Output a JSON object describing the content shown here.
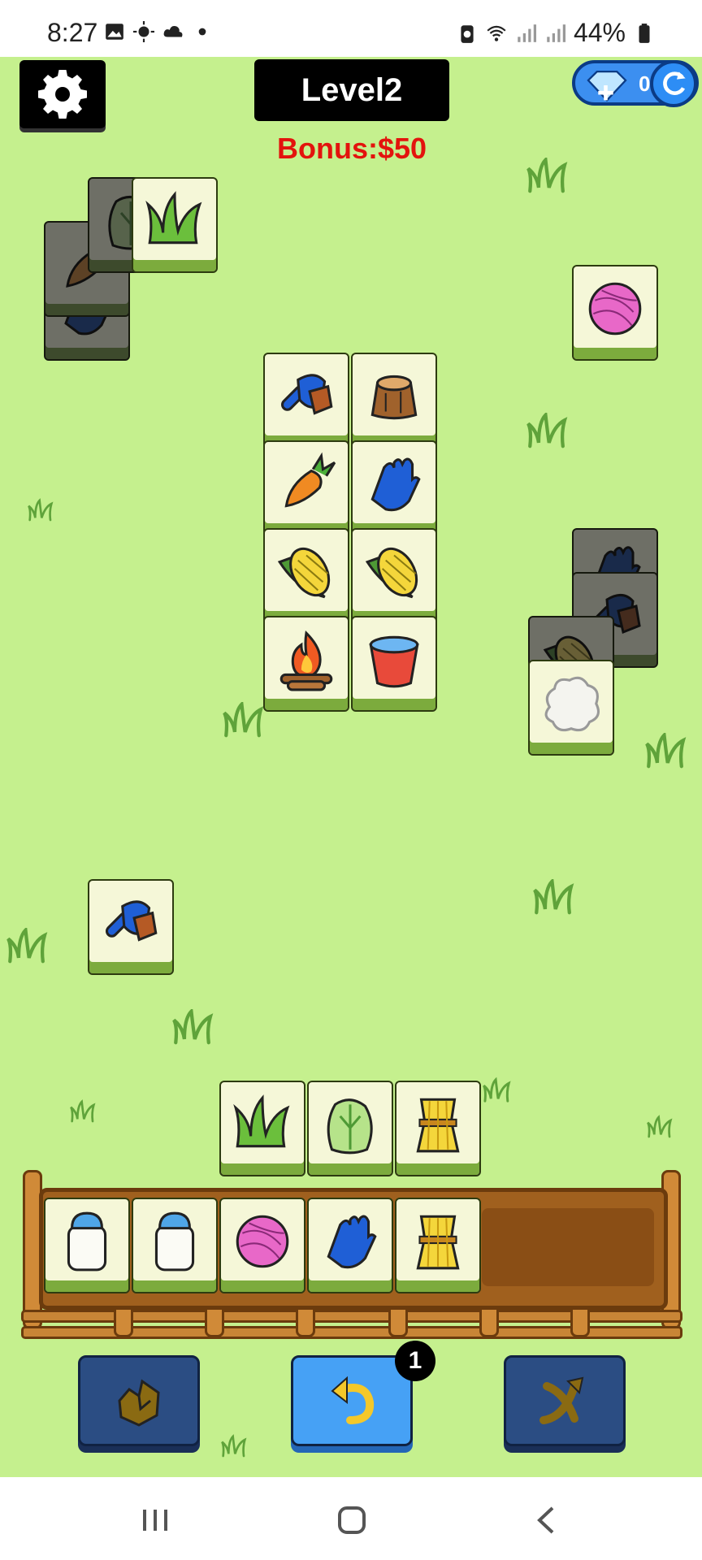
{
  "status_bar": {
    "time": "8:27",
    "battery": "44%",
    "left_icons": [
      "image-icon",
      "sun-icon",
      "cloud-icon",
      "dot-icon"
    ],
    "right_icons": [
      "battery-saver-icon",
      "wifi-icon",
      "signal-icon",
      "signal-icon",
      "battery-icon"
    ]
  },
  "hud": {
    "level": "Level2",
    "bonus": "Bonus:$50",
    "gems": "0",
    "settings_icon": "gear-icon",
    "refresh_icon": "refresh-icon"
  },
  "board_tiles": [
    {
      "icon": "grass-icon",
      "dimmed": false
    },
    {
      "icon": "lettuce-icon",
      "dimmed": true
    },
    {
      "icon": "carrot-icon",
      "dimmed": true
    },
    {
      "icon": "glove-icon",
      "dimmed": true
    },
    {
      "icon": "yarn-ball-icon",
      "dimmed": false
    },
    {
      "icon": "brush-icon",
      "dimmed": false
    },
    {
      "icon": "tree-stump-icon",
      "dimmed": false
    },
    {
      "icon": "carrot-icon",
      "dimmed": false
    },
    {
      "icon": "glove-icon",
      "dimmed": false
    },
    {
      "icon": "corn-icon",
      "dimmed": false
    },
    {
      "icon": "corn-icon",
      "dimmed": false
    },
    {
      "icon": "campfire-icon",
      "dimmed": false
    },
    {
      "icon": "water-bucket-icon",
      "dimmed": false
    },
    {
      "icon": "glove-icon",
      "dimmed": true
    },
    {
      "icon": "brush-icon",
      "dimmed": true
    },
    {
      "icon": "corn-icon",
      "dimmed": true
    },
    {
      "icon": "wool-icon",
      "dimmed": false
    },
    {
      "icon": "brush-icon",
      "dimmed": false
    },
    {
      "icon": "grass-icon",
      "dimmed": false
    },
    {
      "icon": "lettuce-icon",
      "dimmed": false
    },
    {
      "icon": "wheat-icon",
      "dimmed": false
    }
  ],
  "tray": {
    "slots_total": 7,
    "items": [
      "milk-jar-icon",
      "milk-jar-icon",
      "yarn-ball-icon",
      "glove-icon",
      "wheat-icon"
    ]
  },
  "tools": {
    "remove_icon": "tile-remove-icon",
    "undo_icon": "undo-icon",
    "undo_count": "1",
    "shuffle_icon": "shuffle-icon"
  },
  "nav": {
    "recent_icon": "recent-apps-icon",
    "home_icon": "home-icon",
    "back_icon": "back-icon"
  },
  "colors": {
    "grass": "#c5f08e",
    "bonus": "#e3130d",
    "tile": "#f5f7d8",
    "tile_base": "#7cab3d",
    "tray": "#a0601e"
  }
}
